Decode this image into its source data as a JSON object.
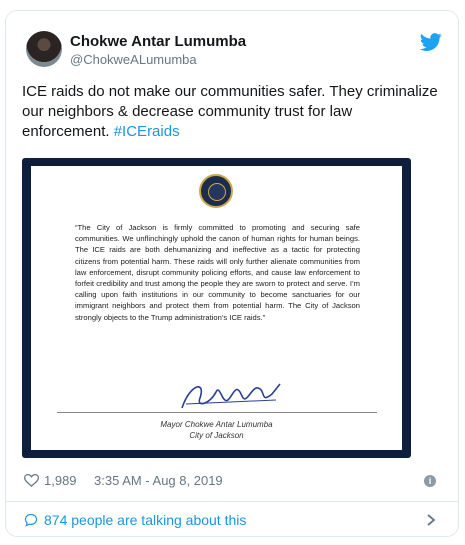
{
  "tweet": {
    "author_name": "Chokwe Antar Lumumba",
    "author_handle": "@ChokweALumumba",
    "text_main": "ICE raids do not make our communities safer.  They criminalize our neighbors & decrease community trust for law enforcement. ",
    "hashtag": "#ICEraids",
    "likes": "1,989",
    "timestamp": "3:35 AM - Aug 8, 2019",
    "talking": "874 people are talking about this"
  },
  "statement": {
    "body": "“The City of Jackson is firmly committed to promoting and securing safe communities. We unflinchingly uphold the canon of human rights for human beings. The ICE raids are both dehumanizing and ineffective as a tactic for protecting citizens from potential harm. These raids will only further alienate communities from law enforcement, disrupt community policing efforts, and cause law enforcement to forfeit credibility and trust among the people they are sworn to protect and serve. I’m calling upon faith institutions in our community to become sanctuaries for our immigrant neighbors and protect them from potential harm. The City of Jackson strongly objects to the Trump administration’s ICE raids.”",
    "signer": "Mayor Chokwe Antar Lumumba",
    "city": "City of Jackson"
  },
  "colors": {
    "accent": "#1b95e0",
    "text": "#14171a",
    "muted": "#657786",
    "media_bg": "#0e1e3d"
  },
  "icons": [
    "twitter-bird-icon",
    "heart-icon",
    "info-icon",
    "reply-bubble-icon",
    "chevron-right-icon",
    "city-seal-icon"
  ]
}
